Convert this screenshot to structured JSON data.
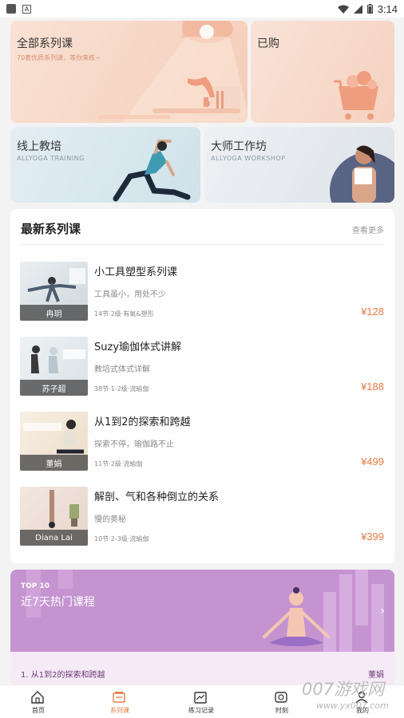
{
  "status_bar": {
    "time": "3:14"
  },
  "banners": {
    "all_courses": {
      "title": "全部系列课",
      "subtitle": "70套优质系列课，等你来练~"
    },
    "purchased": {
      "title": "已购"
    },
    "online_training": {
      "title": "线上教培",
      "subtitle": "ALLYOGA TRAINING"
    },
    "master_workshop": {
      "title": "大师工作坊",
      "subtitle": "ALLYOGA WORKSHOP"
    }
  },
  "latest": {
    "heading": "最新系列课",
    "more_label": "查看更多",
    "courses": [
      {
        "teacher": "冉玥",
        "title": "小工具塑型系列课",
        "desc": "工具虽小，用处不少",
        "meta": "14节·2级·有氧&塑形",
        "price": "¥128"
      },
      {
        "teacher": "苏子超",
        "title": "Suzy瑜伽体式讲解",
        "desc": "教培式体式详解",
        "meta": "38节·1-2级·流瑜伽",
        "price": "¥188"
      },
      {
        "teacher": "董娟",
        "title": "从1到2的探索和跨越",
        "desc": "探索不停，瑜伽路不止",
        "meta": "11节·2级·流瑜伽",
        "price": "¥499"
      },
      {
        "teacher": "Diana Lai",
        "title": "解剖、气和各种倒立的关系",
        "desc": "慢的奥秘",
        "meta": "10节·2-3级·流瑜伽",
        "price": "¥399"
      }
    ]
  },
  "top10": {
    "tag": "TOP 10",
    "title": "近7天热门课程",
    "first_item": "1. 从1到2的探索和跨越",
    "first_author": "董娟"
  },
  "tabbar": {
    "items": [
      {
        "label": "首页"
      },
      {
        "label": "系列课"
      },
      {
        "label": "练习记录"
      },
      {
        "label": "时刻"
      },
      {
        "label": "我的"
      }
    ]
  },
  "watermark": {
    "big": "007游戏网",
    "small": "www.yx007.com"
  },
  "colors": {
    "accent": "#e77a45",
    "top10_bg": "#c594d0"
  }
}
